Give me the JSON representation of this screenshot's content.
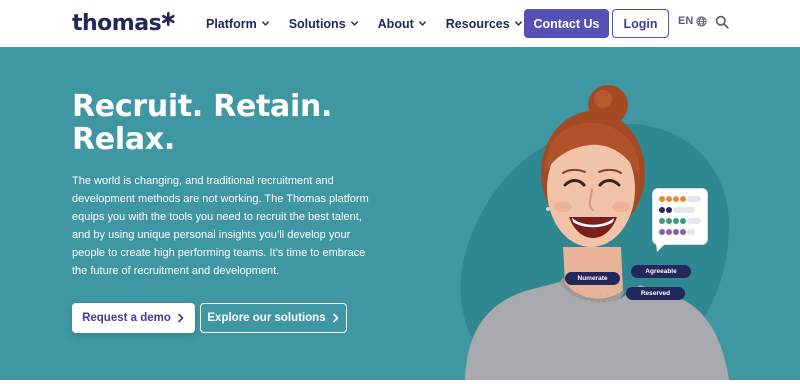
{
  "header": {
    "logo_text": "thomas",
    "nav": [
      {
        "label": "Platform"
      },
      {
        "label": "Solutions"
      },
      {
        "label": "About"
      },
      {
        "label": "Resources"
      }
    ],
    "contact_label": "Contact Us",
    "login_label": "Login",
    "language": "EN",
    "icons": [
      "star-logo-icon",
      "chevron-down-icon",
      "globe-icon",
      "search-icon"
    ]
  },
  "hero": {
    "headline_line1": "Recruit. Retain.",
    "headline_line2": "Relax.",
    "body": "The world is changing, and traditional recruitment and development methods are not working. The Thomas platform equips you with the tools you need to recruit the best talent, and by using unique personal insights you’ll develop your people to create high performing teams. It’s time to embrace the future of recruitment and development.",
    "primary_cta": "Request a demo",
    "secondary_cta": "Explore our solutions",
    "tags": {
      "numerate": "Numerate",
      "agreeable": "Agreeable",
      "reserved": "Reserved"
    }
  },
  "colors": {
    "brand_navy": "#23275a",
    "accent_purple": "#5651b7",
    "hero_teal": "#3f97a4",
    "blob_teal": "#2f8791",
    "dot_orange": "#e88a3a",
    "dot_navy": "#23275a",
    "dot_green": "#3e9a78",
    "dot_purple": "#8a5ea8"
  }
}
